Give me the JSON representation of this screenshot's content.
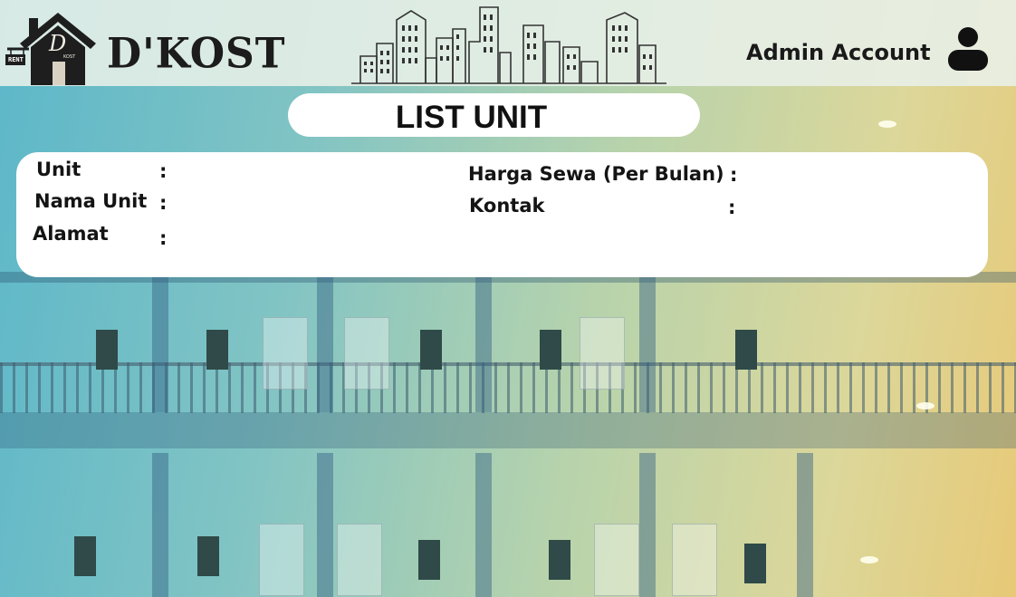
{
  "header": {
    "brand": "D'KOST",
    "logo_sign_text": "RENT",
    "logo_letter": "D",
    "logo_small_text": "KOST",
    "account_label": "Admin Account",
    "icons": {
      "user": "user-icon",
      "skyline": "city-skyline-icon",
      "house": "house-logo-icon"
    }
  },
  "page": {
    "title": "LIST UNIT"
  },
  "details": {
    "colon": ":",
    "left": [
      {
        "label": "Unit",
        "value": ""
      },
      {
        "label": "Nama Unit",
        "value": ""
      },
      {
        "label": "Alamat",
        "value": ""
      }
    ],
    "right": [
      {
        "label": "Harga Sewa (Per Bulan)",
        "value": ""
      },
      {
        "label": "Kontak",
        "value": ""
      }
    ]
  },
  "colors": {
    "header_bg": "#e8f0e8",
    "card_bg": "#ffffff",
    "text": "#141414",
    "bg_teal": "#5cb7c9",
    "bg_yellow": "#e7c977"
  }
}
